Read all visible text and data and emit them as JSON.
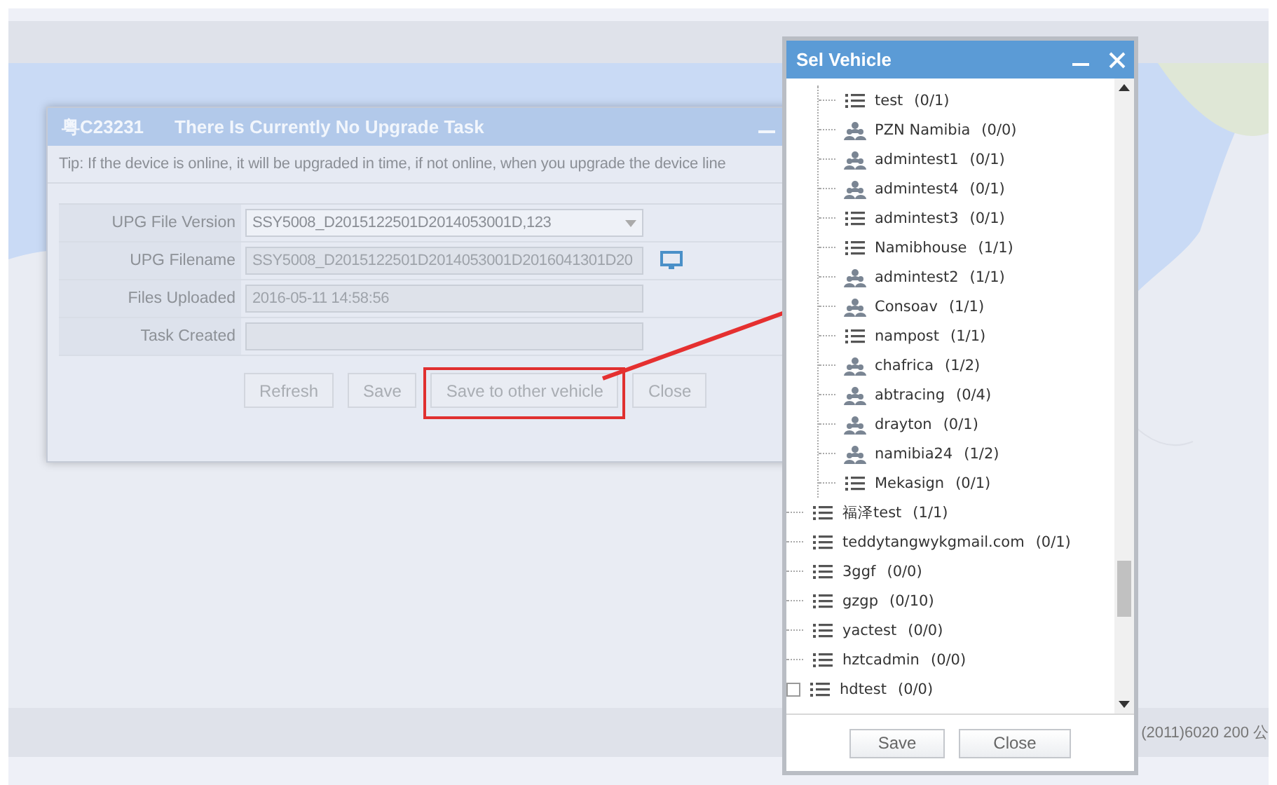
{
  "map": {
    "footer": "(2011)6020 200 公"
  },
  "upgrade_dialog": {
    "plate": "粤C23231",
    "title": "There Is Currently No Upgrade Task",
    "tip": "Tip: If the device is online, it will be upgraded in time, if not online, when you upgrade the device line",
    "fields": [
      {
        "kind": "select",
        "label": "UPG File Version",
        "value": "SSY5008_D2015122501D2014053001D,123"
      },
      {
        "kind": "file",
        "label": "UPG Filename",
        "value": "SSY5008_D2015122501D2014053001D2016041301D20"
      },
      {
        "kind": "text",
        "label": "Files Uploaded",
        "value": "2016-05-11 14:58:56"
      },
      {
        "kind": "text",
        "label": "Task Created"
      }
    ],
    "buttons": [
      {
        "label": "Refresh",
        "highlighted": false
      },
      {
        "label": "Save",
        "highlighted": false
      },
      {
        "label": "Save to other vehicle",
        "highlighted": true
      },
      {
        "label": "Close",
        "highlighted": false
      }
    ]
  },
  "vehicle_dialog": {
    "title": "Sel Vehicle",
    "tree": [
      {
        "expanded": true,
        "children": [
          {
            "kind": "list",
            "name": "test",
            "count": "(0/1)"
          },
          {
            "kind": "group",
            "name": "PZN Namibia",
            "count": "(0/0)"
          },
          {
            "kind": "group",
            "name": "admintest1",
            "count": "(0/1)"
          },
          {
            "kind": "group",
            "name": "admintest4",
            "count": "(0/1)"
          },
          {
            "kind": "list",
            "name": "admintest3",
            "count": "(0/1)"
          },
          {
            "kind": "list",
            "name": "Namibhouse",
            "count": "(1/1)"
          },
          {
            "kind": "group",
            "name": "admintest2",
            "count": "(1/1)"
          },
          {
            "kind": "group",
            "name": "Consoav",
            "count": "(1/1)"
          },
          {
            "kind": "list",
            "name": "nampost",
            "count": "(1/1)"
          },
          {
            "kind": "group",
            "name": "chafrica",
            "count": "(1/2)"
          },
          {
            "kind": "group",
            "name": "abtracing",
            "count": "(0/4)"
          },
          {
            "kind": "group",
            "name": "drayton",
            "count": "(0/1)"
          },
          {
            "kind": "group",
            "name": "namibia24",
            "count": "(1/2)"
          },
          {
            "kind": "list",
            "name": "Mekasign",
            "count": "(0/1)"
          }
        ]
      },
      {
        "kind": "list",
        "name": "福泽test",
        "count": "(1/1)"
      },
      {
        "kind": "list",
        "name": "teddytangwykgmail.com",
        "count": "(0/1)"
      },
      {
        "kind": "list",
        "name": "3ggf",
        "count": "(0/0)"
      },
      {
        "kind": "list",
        "name": "gzgp",
        "count": "(0/10)"
      },
      {
        "kind": "list",
        "name": "yactest",
        "count": "(0/0)"
      },
      {
        "kind": "list",
        "name": "hztcadmin",
        "count": "(0/0)"
      },
      {
        "kind": "list",
        "name": "hdtest",
        "count": "(0/0)",
        "expanded": false
      }
    ],
    "buttons": [
      "Save",
      "Close"
    ]
  }
}
